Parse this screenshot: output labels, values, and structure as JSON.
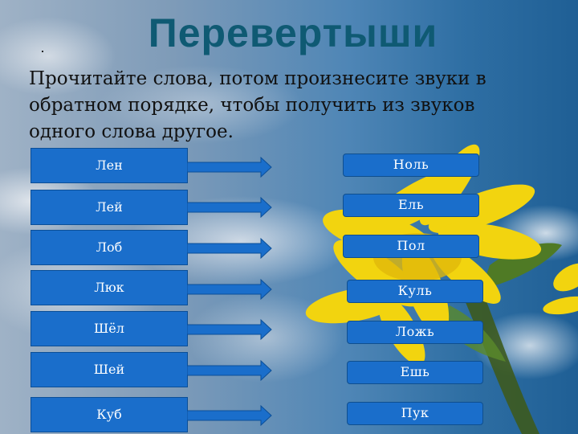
{
  "slide": {
    "title": "Перевертыши",
    "instruction": "Прочитайте слова, потом произнесите звуки в обратном порядке, чтобы получить из звуков одного слова другое."
  },
  "colors": {
    "title": "#0f5a73",
    "box_fill": "#1a6ecb",
    "box_border": "#0b4f98",
    "box_text": "#ffffff"
  },
  "left_words": [
    "Лен",
    "Лей",
    "Лоб",
    "Люк",
    "Шёл",
    "Шей",
    "Куб"
  ],
  "right_words": [
    "Ноль",
    "Ель",
    "Пол",
    "Куль",
    "Ложь",
    "Ешь",
    "Пук"
  ],
  "icons": {
    "arrow": "arrow-right-icon"
  }
}
